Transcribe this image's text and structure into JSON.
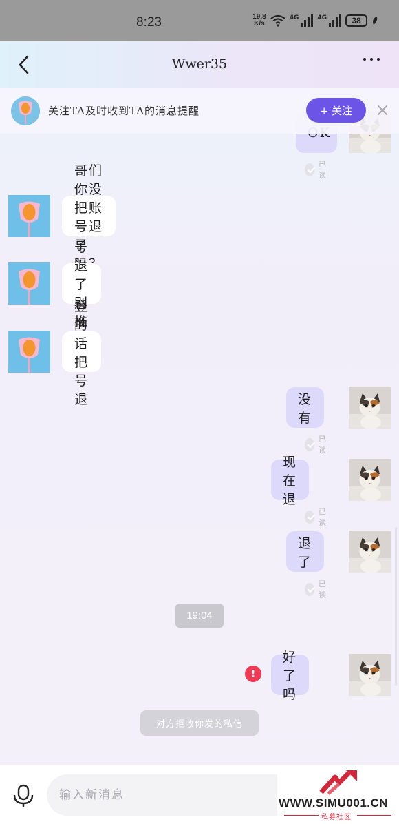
{
  "status_bar": {
    "time": "8:23",
    "net_speed_value": "19.8",
    "net_speed_unit": "K/s",
    "signal_1_label": "4G",
    "signal_2_label": "4G",
    "battery": "38"
  },
  "header": {
    "title": "Wwer35"
  },
  "follow_bar": {
    "text": "关注TA及时收到TA的消息提醒",
    "button_label": "+ 关注"
  },
  "messages": [
    {
      "side": "right",
      "text": "OK",
      "read": "已读"
    },
    {
      "side": "left",
      "text": "哥们你没把账号退了吗？"
    },
    {
      "side": "left",
      "text": "号退了别推"
    },
    {
      "side": "left",
      "text": "登的话把号退"
    },
    {
      "side": "right",
      "text": "没有",
      "read": "已读"
    },
    {
      "side": "right",
      "text": "现在退",
      "read": "已读"
    },
    {
      "side": "right",
      "text": "退了",
      "read": "已读"
    },
    {
      "side": "right",
      "text": "好了吗",
      "failed": true
    }
  ],
  "time_divider": "19:04",
  "system_notice": "对方拒收你发的私信",
  "input": {
    "placeholder": "输入新消息"
  },
  "watermark": {
    "site": "WWW.SIMU001.CN",
    "sub": "私募社区"
  },
  "colors": {
    "accent": "#6c55e6",
    "sent_bubble": "#dcd9fb",
    "received_bubble": "#ffffff",
    "error": "#ef3a55"
  }
}
